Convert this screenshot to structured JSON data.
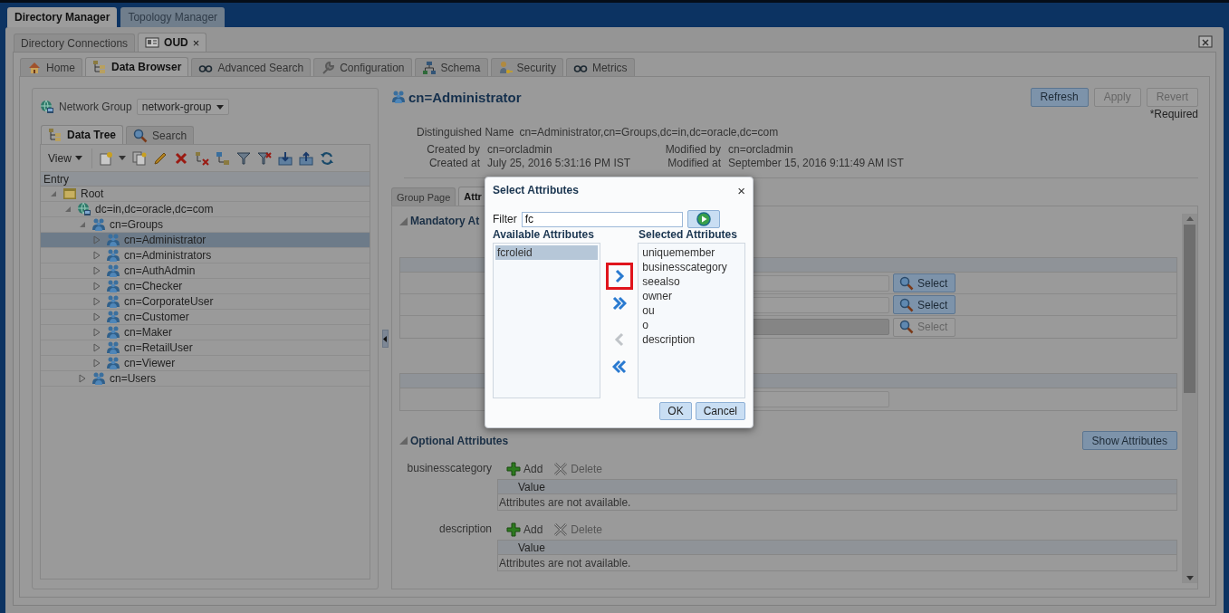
{
  "app_tabs": [
    {
      "label": "Directory Manager",
      "selected": true
    },
    {
      "label": "Topology Manager",
      "selected": false
    }
  ],
  "connection_tabs": [
    {
      "label": "Directory Connections",
      "selected": false
    },
    {
      "label": "OUD",
      "selected": true,
      "close": "×"
    }
  ],
  "section_tabs": [
    {
      "label": "Home",
      "selected": false
    },
    {
      "label": "Data Browser",
      "selected": true
    },
    {
      "label": "Advanced Search",
      "selected": false
    },
    {
      "label": "Configuration",
      "selected": false
    },
    {
      "label": "Schema",
      "selected": false
    },
    {
      "label": "Security",
      "selected": false
    },
    {
      "label": "Metrics",
      "selected": false
    }
  ],
  "left_panel": {
    "network_group": {
      "label": "Network Group",
      "value": "network-group"
    },
    "tabs": [
      {
        "label": "Data Tree",
        "selected": true
      },
      {
        "label": "Search",
        "selected": false
      }
    ],
    "view_menu": "View",
    "tree": {
      "column": "Entry",
      "nodes": [
        {
          "label": "Root",
          "kind": "root",
          "expanded": true,
          "selected": false,
          "children": [
            {
              "label": "dc=in,dc=oracle,dc=com",
              "kind": "domain",
              "expanded": true,
              "selected": false,
              "children": [
                {
                  "label": "cn=Groups",
                  "kind": "group",
                  "expanded": true,
                  "selected": false,
                  "children": [
                    {
                      "label": "cn=Administrator",
                      "kind": "group",
                      "expanded": false,
                      "selected": true
                    },
                    {
                      "label": "cn=Administrators",
                      "kind": "group",
                      "expanded": false,
                      "selected": false
                    },
                    {
                      "label": "cn=AuthAdmin",
                      "kind": "group",
                      "expanded": false,
                      "selected": false
                    },
                    {
                      "label": "cn=Checker",
                      "kind": "group",
                      "expanded": false,
                      "selected": false
                    },
                    {
                      "label": "cn=CorporateUser",
                      "kind": "group",
                      "expanded": false,
                      "selected": false
                    },
                    {
                      "label": "cn=Customer",
                      "kind": "group",
                      "expanded": false,
                      "selected": false
                    },
                    {
                      "label": "cn=Maker",
                      "kind": "group",
                      "expanded": false,
                      "selected": false
                    },
                    {
                      "label": "cn=RetailUser",
                      "kind": "group",
                      "expanded": false,
                      "selected": false
                    },
                    {
                      "label": "cn=Viewer",
                      "kind": "group",
                      "expanded": false,
                      "selected": false
                    }
                  ]
                },
                {
                  "label": "cn=Users",
                  "kind": "group",
                  "expanded": false,
                  "selected": false
                }
              ]
            }
          ]
        }
      ]
    }
  },
  "entry": {
    "title": "cn=Administrator",
    "actions": [
      {
        "label": "Refresh",
        "disabled": false
      },
      {
        "label": "Apply",
        "disabled": true
      },
      {
        "label": "Revert",
        "disabled": true
      }
    ],
    "required_note": "*Required",
    "dn": {
      "label": "Distinguished Name",
      "value": "cn=Administrator,cn=Groups,dc=in,dc=oracle,dc=com"
    },
    "details": [
      {
        "label": "Created by",
        "value": "cn=orcladmin"
      },
      {
        "label": "Modified by",
        "value": "cn=orcladmin"
      },
      {
        "label": "Created at",
        "value": "July 25, 2016 5:31:16 PM IST"
      },
      {
        "label": "Modified at",
        "value": "September 15, 2016 9:11:49 AM IST"
      }
    ],
    "tabs": [
      {
        "label": "Group Page",
        "selected": false
      },
      {
        "label": "Attr",
        "selected": true
      }
    ],
    "mandatory": {
      "title": "Mandatory At",
      "tables": [
        {
          "rows": [
            {
              "select": "Select",
              "disabled": false
            },
            {
              "select": "Select",
              "disabled": false
            },
            {
              "select": "Select",
              "disabled": true
            }
          ]
        },
        {
          "rows": [
            {
              "disabled": false
            }
          ]
        }
      ]
    },
    "optional": {
      "title": "Optional Attributes",
      "show_button": "Show Attributes",
      "attributes": [
        {
          "name": "businesscategory",
          "add": "Add",
          "delete": "Delete",
          "column": "Value",
          "empty": "Attributes are not available."
        },
        {
          "name": "description",
          "add": "Add",
          "delete": "Delete",
          "column": "Value",
          "empty": "Attributes are not available."
        }
      ]
    }
  },
  "dialog": {
    "title": "Select Attributes",
    "close": "×",
    "filter_label": "Filter",
    "filter_value": "fc",
    "available": {
      "title": "Available Attributes",
      "items": [
        {
          "label": "fcroleid",
          "selected": true
        }
      ]
    },
    "selected": {
      "title": "Selected Attributes",
      "items": [
        {
          "label": "uniquemember",
          "selected": false
        },
        {
          "label": "businesscategory",
          "selected": false
        },
        {
          "label": "seealso",
          "selected": false
        },
        {
          "label": "owner",
          "selected": false
        },
        {
          "label": "ou",
          "selected": false
        },
        {
          "label": "o",
          "selected": false
        },
        {
          "label": "description",
          "selected": false
        }
      ]
    },
    "shuttle": [
      {
        "kind": "move",
        "disabled": false,
        "highlighted": true
      },
      {
        "kind": "move_all",
        "disabled": false,
        "highlighted": false
      },
      {
        "kind": "remove",
        "disabled": true,
        "highlighted": false
      },
      {
        "kind": "remove_all",
        "disabled": false,
        "highlighted": false
      }
    ],
    "buttons": [
      "OK",
      "Cancel"
    ]
  }
}
